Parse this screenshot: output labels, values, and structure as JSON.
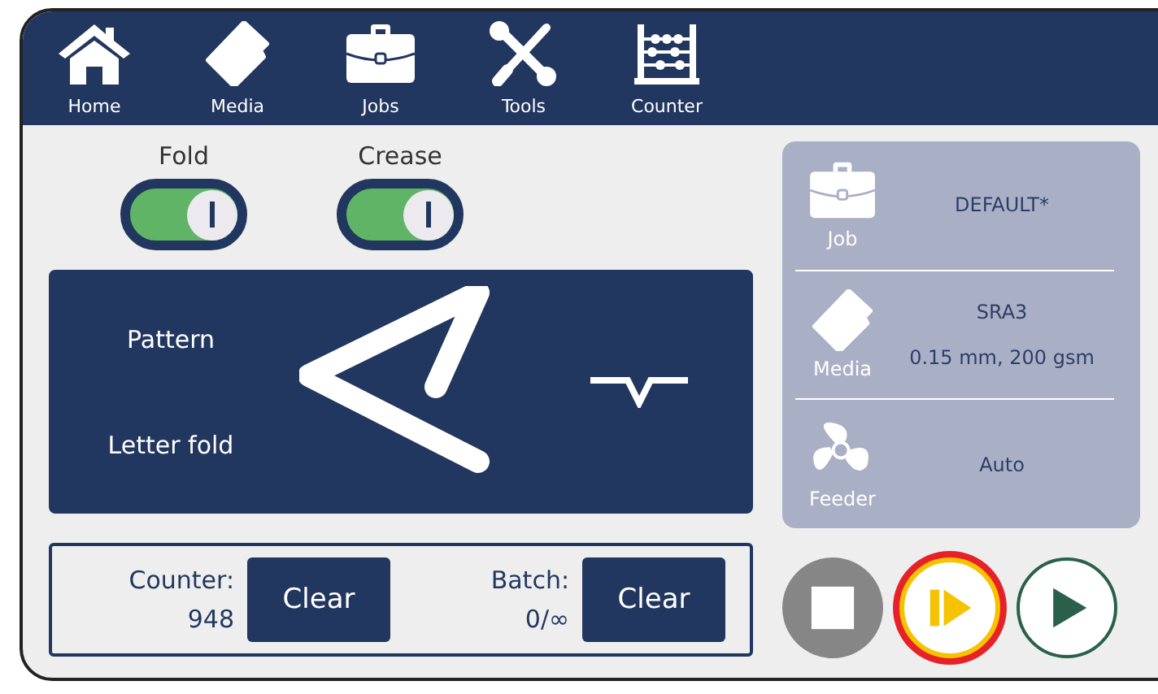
{
  "nav": [
    {
      "label": "Home",
      "kind": "home"
    },
    {
      "label": "Media",
      "kind": "media"
    },
    {
      "label": "Jobs",
      "kind": "jobs"
    },
    {
      "label": "Tools",
      "kind": "tools"
    },
    {
      "label": "Counter",
      "kind": "counter"
    }
  ],
  "toggles": [
    {
      "label": "Fold",
      "on": true
    },
    {
      "label": "Crease",
      "on": true
    }
  ],
  "pattern": {
    "label": "Pattern",
    "name": "Letter fold"
  },
  "counters": [
    {
      "label": "Counter:",
      "value": "948",
      "button": "Clear"
    },
    {
      "label": "Batch:",
      "value": "0/∞",
      "button": "Clear"
    }
  ],
  "info": [
    {
      "kind": "job",
      "label": "Job",
      "lines": [
        "DEFAULT*"
      ]
    },
    {
      "kind": "media",
      "label": "Media",
      "lines": [
        "SRA3",
        "0.15 mm, 200 gsm"
      ]
    },
    {
      "kind": "feeder",
      "label": "Feeder",
      "lines": [
        "Auto"
      ]
    }
  ],
  "controls": [
    {
      "kind": "stop",
      "highlighted": false
    },
    {
      "kind": "step",
      "highlighted": true
    },
    {
      "kind": "play",
      "highlighted": false
    }
  ]
}
